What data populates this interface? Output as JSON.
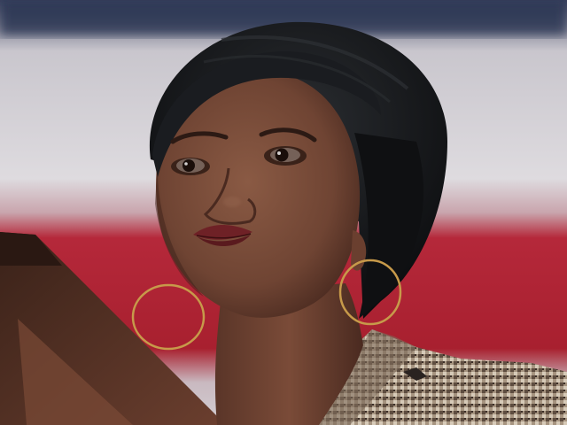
{
  "photo": {
    "subject": "portrait",
    "colors": {
      "flag_white": "#dcd9dc",
      "flag_red": "#b5283a",
      "flag_blue": "#25304f",
      "skin": "#7b4e3a",
      "skin_shadow": "#5a3528",
      "headwrap": "#15171a",
      "earring_gold": "#c79a4a",
      "jacket_tweed": "#9c8b78",
      "podium": "#4a2c22",
      "lips": "#6e2126"
    }
  }
}
